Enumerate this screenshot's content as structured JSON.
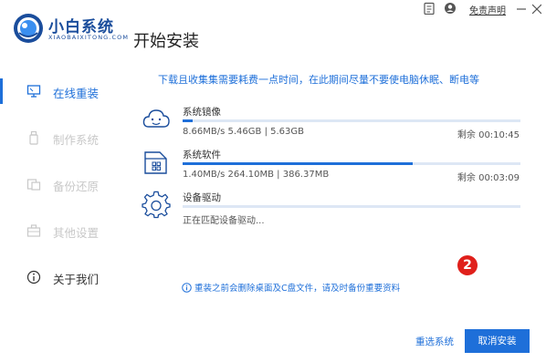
{
  "header": {
    "brand_name": "小白系统",
    "brand_sub": "XIAOBAIXITONG.COM",
    "page_title": "开始安装",
    "disclaimer": "免责声明",
    "icons": [
      "clipboard-icon",
      "user-icon",
      "minimize-icon",
      "close-icon"
    ]
  },
  "sidebar": {
    "items": [
      {
        "label": "在线重装",
        "icon": "monitor-icon",
        "state": "active"
      },
      {
        "label": "制作系统",
        "icon": "usb-icon",
        "state": "disabled"
      },
      {
        "label": "备份还原",
        "icon": "backup-icon",
        "state": "disabled"
      },
      {
        "label": "其他设置",
        "icon": "briefcase-icon",
        "state": "disabled"
      },
      {
        "label": "关于我们",
        "icon": "info-icon",
        "state": "normal"
      }
    ]
  },
  "main": {
    "notice": "下载且收集集需要耗费一点时间，在此期间尽量不要使电脑休眠、断电等",
    "tasks": [
      {
        "name": "系统镜像",
        "stats": "8.66MB/s 5.46GB | 5.63GB",
        "remaining": "剩余 00:10:45",
        "progress": 0.03,
        "icon": "cloud-face-icon"
      },
      {
        "name": "系统软件",
        "stats": "1.40MB/s 264.10MB | 386.37MB",
        "remaining": "剩余 00:03:09",
        "progress": 0.68,
        "icon": "software-folder-icon"
      },
      {
        "name": "设备驱动",
        "stats": "正在匹配设备驱动...",
        "remaining": "",
        "progress": 0.0,
        "icon": "gear-icon"
      }
    ],
    "warning": "重装之前会删除桌面及C盘文件，请及时备份重要资料",
    "badge": "2"
  },
  "footer": {
    "reselect_label": "重选系统",
    "cancel_label": "取消安装"
  },
  "colors": {
    "accent": "#1e6fd9",
    "brand": "#1a4d9c",
    "badge": "#e0201b",
    "disabled": "#c8c8c8"
  }
}
